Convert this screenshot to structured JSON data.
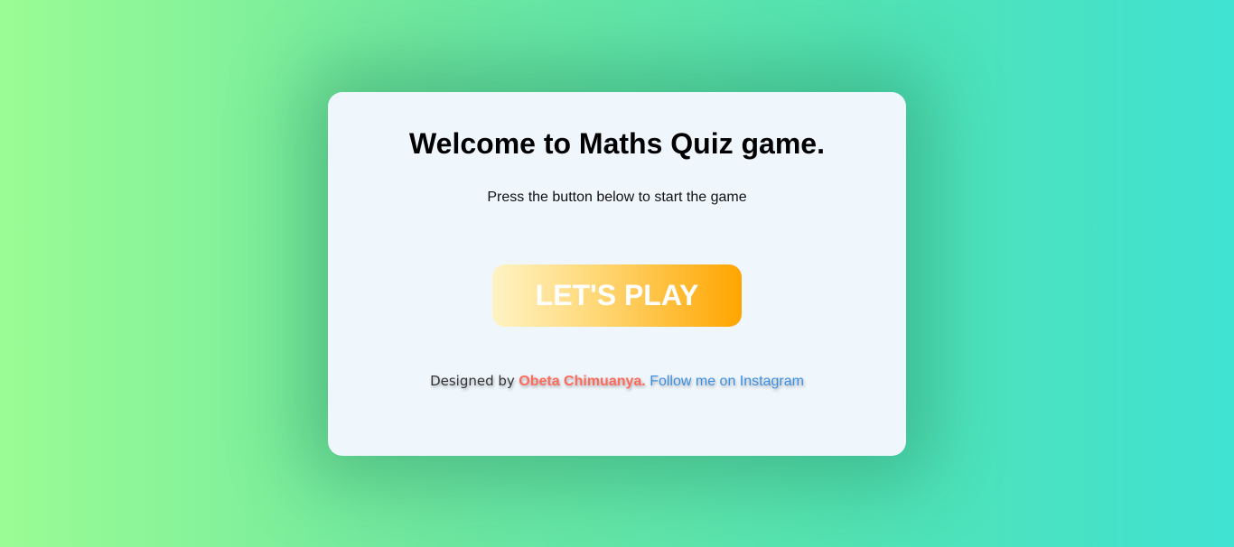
{
  "card": {
    "title": "Welcome to Maths Quiz game.",
    "subtitle": "Press the button below to start the game",
    "play_button_label": "LET'S PLAY",
    "credit": {
      "prefix": "Designed by",
      "author": "Obeta Chimuanya.",
      "link_label": "Follow me on Instagram"
    }
  },
  "colors": {
    "background_left": "#9afc94",
    "background_right": "#40e2d2",
    "card_bg": "#eff6fc",
    "button_gradient_start": "#fff3c4",
    "button_gradient_end": "#ffa500",
    "author_color": "#ff6b5b",
    "link_color": "#3d8fe0"
  }
}
